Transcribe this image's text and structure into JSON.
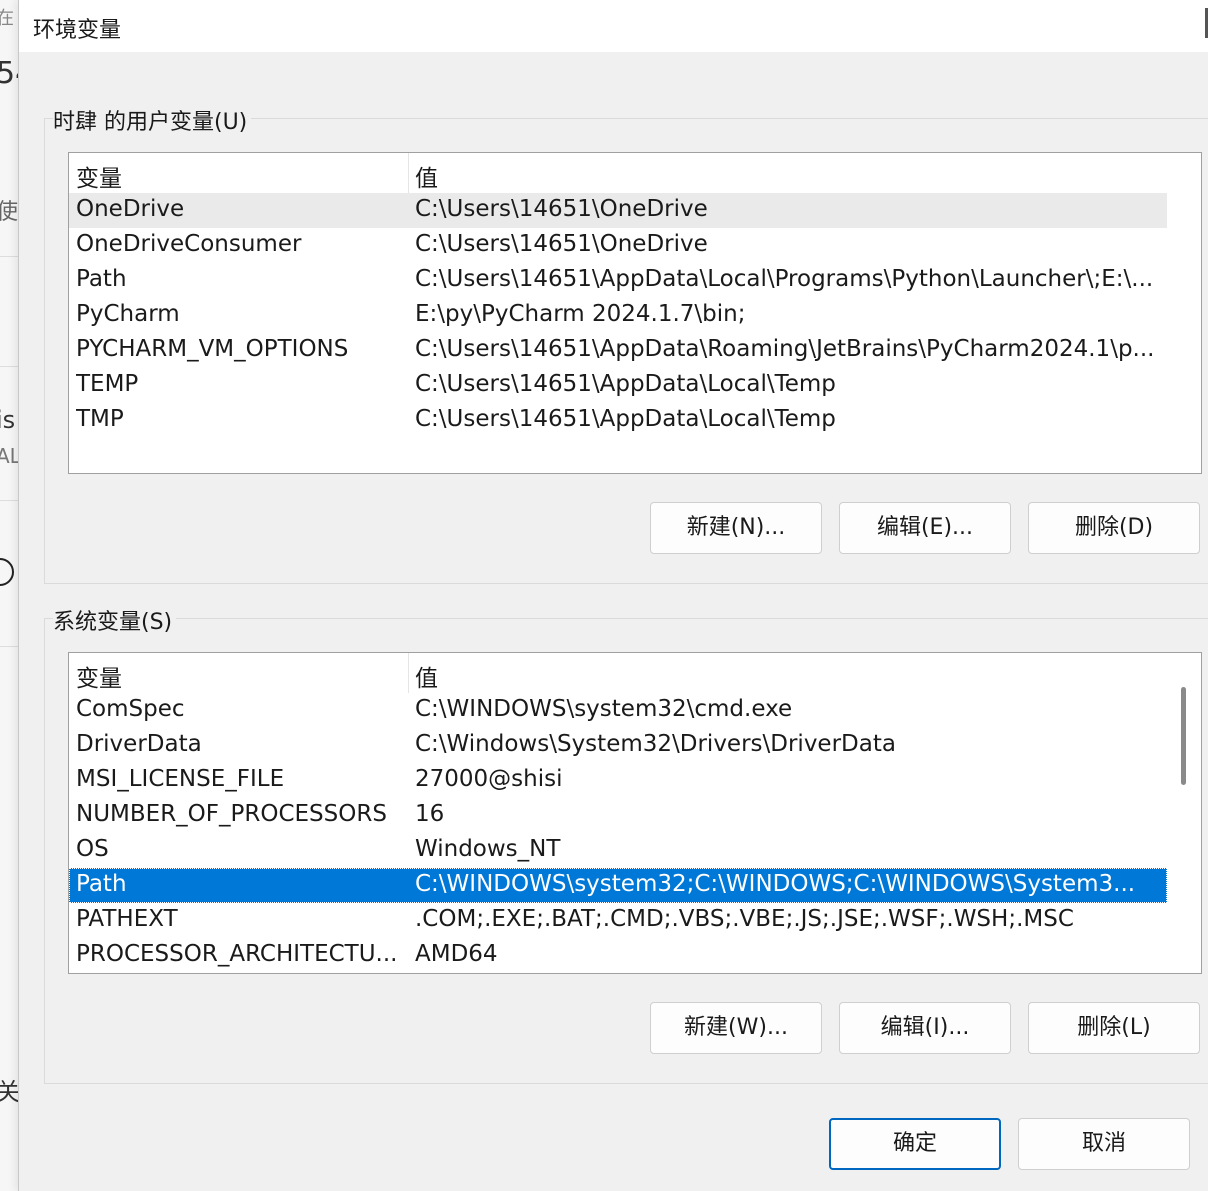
{
  "background_window": {
    "fragments": [
      "在",
      "54",
      "使",
      "is",
      "AL",
      "关"
    ]
  },
  "dialog": {
    "title": "环境变量"
  },
  "user_vars": {
    "group_label": "时肆 的用户变量(U)",
    "col_variable": "变量",
    "col_value": "值",
    "rows": [
      {
        "name": "OneDrive",
        "value": "C:\\Users\\14651\\OneDrive"
      },
      {
        "name": "OneDriveConsumer",
        "value": "C:\\Users\\14651\\OneDrive"
      },
      {
        "name": "Path",
        "value": "C:\\Users\\14651\\AppData\\Local\\Programs\\Python\\Launcher\\;E:\\..."
      },
      {
        "name": "PyCharm",
        "value": "E:\\py\\PyCharm 2024.1.7\\bin;"
      },
      {
        "name": "PYCHARM_VM_OPTIONS",
        "value": "C:\\Users\\14651\\AppData\\Roaming\\JetBrains\\PyCharm2024.1\\p..."
      },
      {
        "name": "TEMP",
        "value": "C:\\Users\\14651\\AppData\\Local\\Temp"
      },
      {
        "name": "TMP",
        "value": "C:\\Users\\14651\\AppData\\Local\\Temp"
      }
    ],
    "new_label": "新建(N)...",
    "edit_label": "编辑(E)...",
    "delete_label": "删除(D)"
  },
  "system_vars": {
    "group_label": "系统变量(S)",
    "col_variable": "变量",
    "col_value": "值",
    "rows": [
      {
        "name": "ComSpec",
        "value": "C:\\WINDOWS\\system32\\cmd.exe"
      },
      {
        "name": "DriverData",
        "value": "C:\\Windows\\System32\\Drivers\\DriverData"
      },
      {
        "name": "MSI_LICENSE_FILE",
        "value": "27000@shisi"
      },
      {
        "name": "NUMBER_OF_PROCESSORS",
        "value": "16"
      },
      {
        "name": "OS",
        "value": "Windows_NT"
      },
      {
        "name": "Path",
        "value": "C:\\WINDOWS\\system32;C:\\WINDOWS;C:\\WINDOWS\\System3..."
      },
      {
        "name": "PATHEXT",
        "value": ".COM;.EXE;.BAT;.CMD;.VBS;.VBE;.JS;.JSE;.WSF;.WSH;.MSC"
      },
      {
        "name": "PROCESSOR_ARCHITECTU...",
        "value": "AMD64"
      }
    ],
    "selected_row": "Path",
    "new_label": "新建(W)...",
    "edit_label": "编辑(I)...",
    "delete_label": "删除(L)"
  },
  "footer": {
    "ok_label": "确定",
    "cancel_label": "取消"
  },
  "colors": {
    "selection": "#0078d7",
    "primary_border": "#0067c0"
  }
}
